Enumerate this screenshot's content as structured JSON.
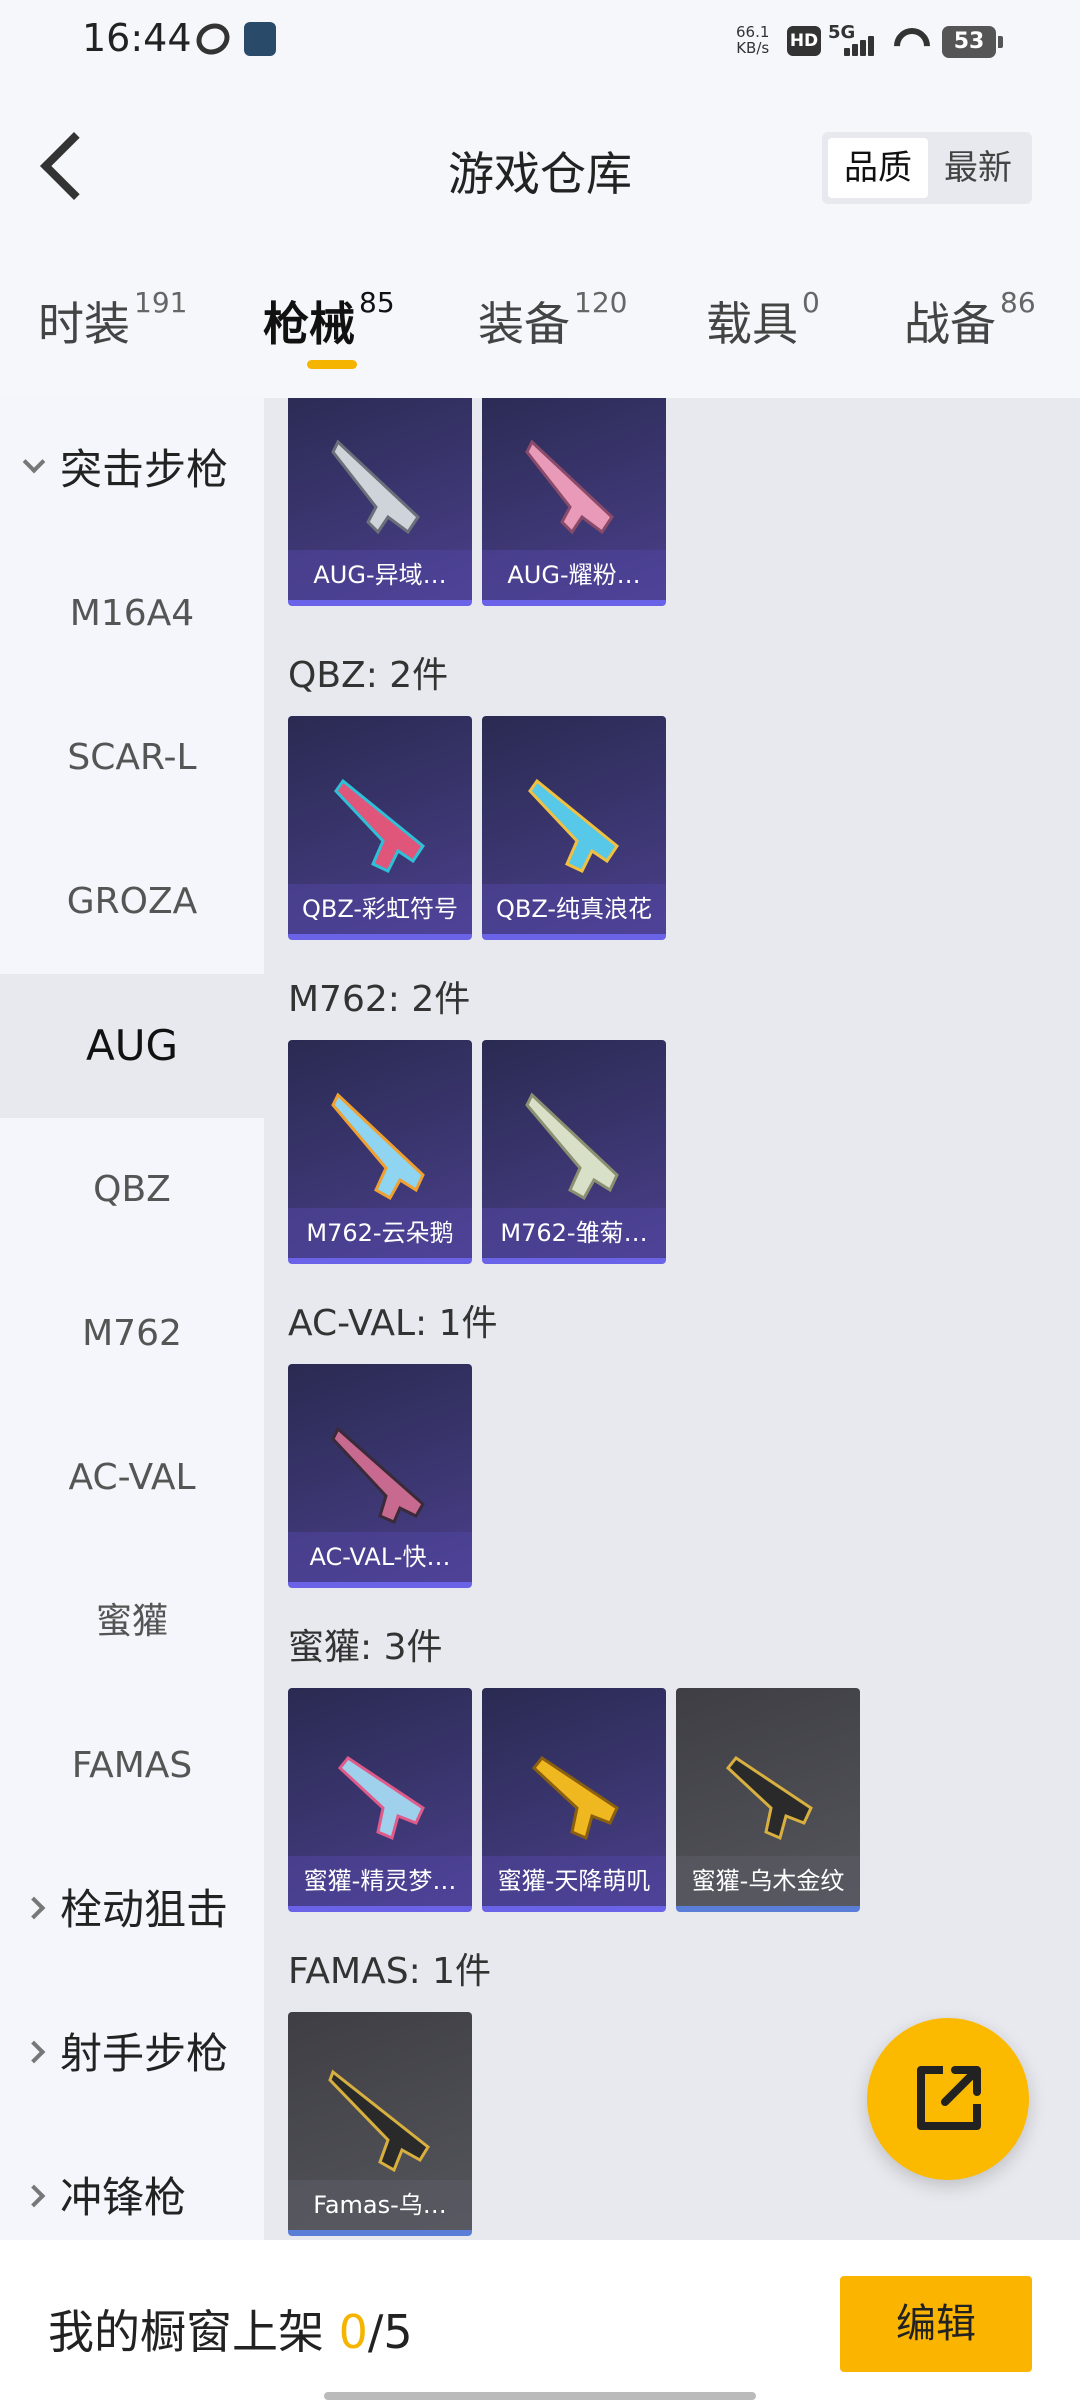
{
  "status_bar": {
    "time": "16:44",
    "net_speed_value": "66.1",
    "net_speed_unit": "KB/s",
    "hd_label": "HD",
    "network": "5G",
    "battery": "53"
  },
  "header": {
    "title": "游戏仓库",
    "sort_options": [
      "品质",
      "最新"
    ],
    "sort_selected": "品质"
  },
  "tabs": [
    {
      "label": "时装",
      "count": "191"
    },
    {
      "label": "枪械",
      "count": "85",
      "active": true
    },
    {
      "label": "装备",
      "count": "120"
    },
    {
      "label": "载具",
      "count": "0"
    },
    {
      "label": "战备",
      "count": "86"
    }
  ],
  "sidebar": {
    "expanded_group": "突击步枪",
    "sub_items": [
      "M16A4",
      "SCAR-L",
      "GROZA",
      "AUG",
      "QBZ",
      "M762",
      "AC-VAL",
      "蜜獾",
      "FAMAS"
    ],
    "active_item": "AUG",
    "collapsed_groups": [
      "栓动狙击",
      "射手步枪",
      "冲锋枪"
    ]
  },
  "content": {
    "aug_items": [
      "AUG-异域…",
      "AUG-耀粉…"
    ],
    "groups": [
      {
        "title": "QBZ: 2件",
        "items": [
          "QBZ-彩虹符号",
          "QBZ-纯真浪花"
        ]
      },
      {
        "title": "M762: 2件",
        "items": [
          "M762-云朵鹅",
          "M762-雏菊…"
        ]
      },
      {
        "title": "AC-VAL: 1件",
        "items": [
          "AC-VAL-快…"
        ]
      },
      {
        "title": "蜜獾: 3件",
        "items": [
          "蜜獾-精灵梦…",
          "蜜獾-天降萌叽",
          "蜜獾-乌木金纹"
        ]
      },
      {
        "title": "FAMAS: 1件",
        "items": [
          "Famas-乌…"
        ]
      }
    ]
  },
  "bottom_bar": {
    "showcase_label": "我的橱窗上架",
    "showcase_current": "0",
    "showcase_total": "/5",
    "edit_button": "编辑"
  },
  "colors": {
    "accent": "#fbb400",
    "card_purple": "#3b3670",
    "card_grey": "#55555c"
  }
}
